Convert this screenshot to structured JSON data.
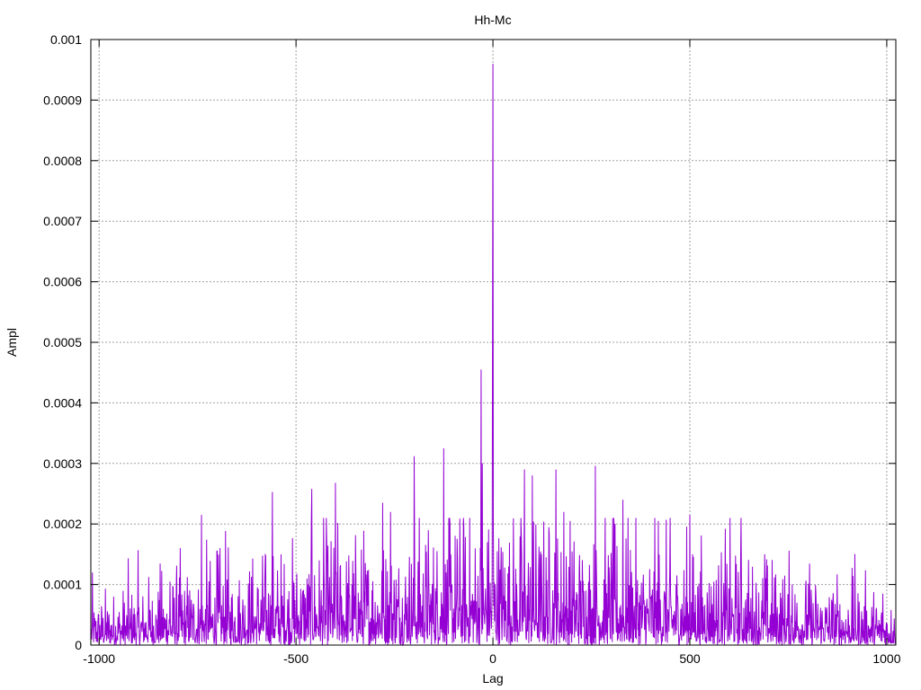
{
  "chart_data": {
    "type": "line",
    "title": "Hh-Mc",
    "xlabel": "Lag",
    "ylabel": "Ampl",
    "xlim": [
      -1021,
      1023
    ],
    "ylim": [
      0,
      0.001
    ],
    "grid": true,
    "legend": "none",
    "x_ticks": [
      -1000,
      -500,
      0,
      500,
      1000
    ],
    "x_tick_labels": [
      "-1000",
      "-500",
      "0",
      "500",
      "1000"
    ],
    "y_ticks": [
      0,
      0.0001,
      0.0002,
      0.0003,
      0.0004,
      0.0005,
      0.0006,
      0.0007,
      0.0008,
      0.0009,
      0.001
    ],
    "y_tick_labels": [
      "0",
      "0.0001",
      "0.0002",
      "0.0003",
      "0.0004",
      "0.0005",
      "0.0006",
      "0.0007",
      "0.0008",
      "0.0009",
      "0.001"
    ],
    "series": [
      {
        "name": "Hh-Mc",
        "color": "#9400d3",
        "x_range": [
          -1020,
          1022
        ],
        "noise_envelope": {
          "edge_mean": 3e-05,
          "center_mean": 8e-05
        },
        "peaks": [
          [
            0,
            0.00096
          ],
          [
            -1,
            0.00053
          ],
          [
            1,
            0.0002
          ],
          [
            -30,
            0.000455
          ],
          [
            -27,
            0.0003
          ],
          [
            -125,
            0.000325
          ],
          [
            -200,
            0.000312
          ],
          [
            -260,
            0.00022
          ],
          [
            -280,
            0.000235
          ],
          [
            -400,
            0.000268
          ],
          [
            -460,
            0.000258
          ],
          [
            -560,
            0.000253
          ],
          [
            -740,
            0.000215
          ],
          [
            -700,
            0.000155
          ],
          [
            -820,
            0.000105
          ],
          [
            80,
            0.00029
          ],
          [
            100,
            0.00028
          ],
          [
            160,
            0.00029
          ],
          [
            260,
            0.000296
          ],
          [
            180,
            0.00022
          ],
          [
            330,
            0.00024
          ],
          [
            420,
            0.000205
          ],
          [
            500,
            0.000215
          ],
          [
            630,
            0.00021
          ],
          [
            690,
            0.00015
          ],
          [
            760,
            0.0001
          ],
          [
            990,
            8.5e-05
          ]
        ]
      }
    ]
  }
}
